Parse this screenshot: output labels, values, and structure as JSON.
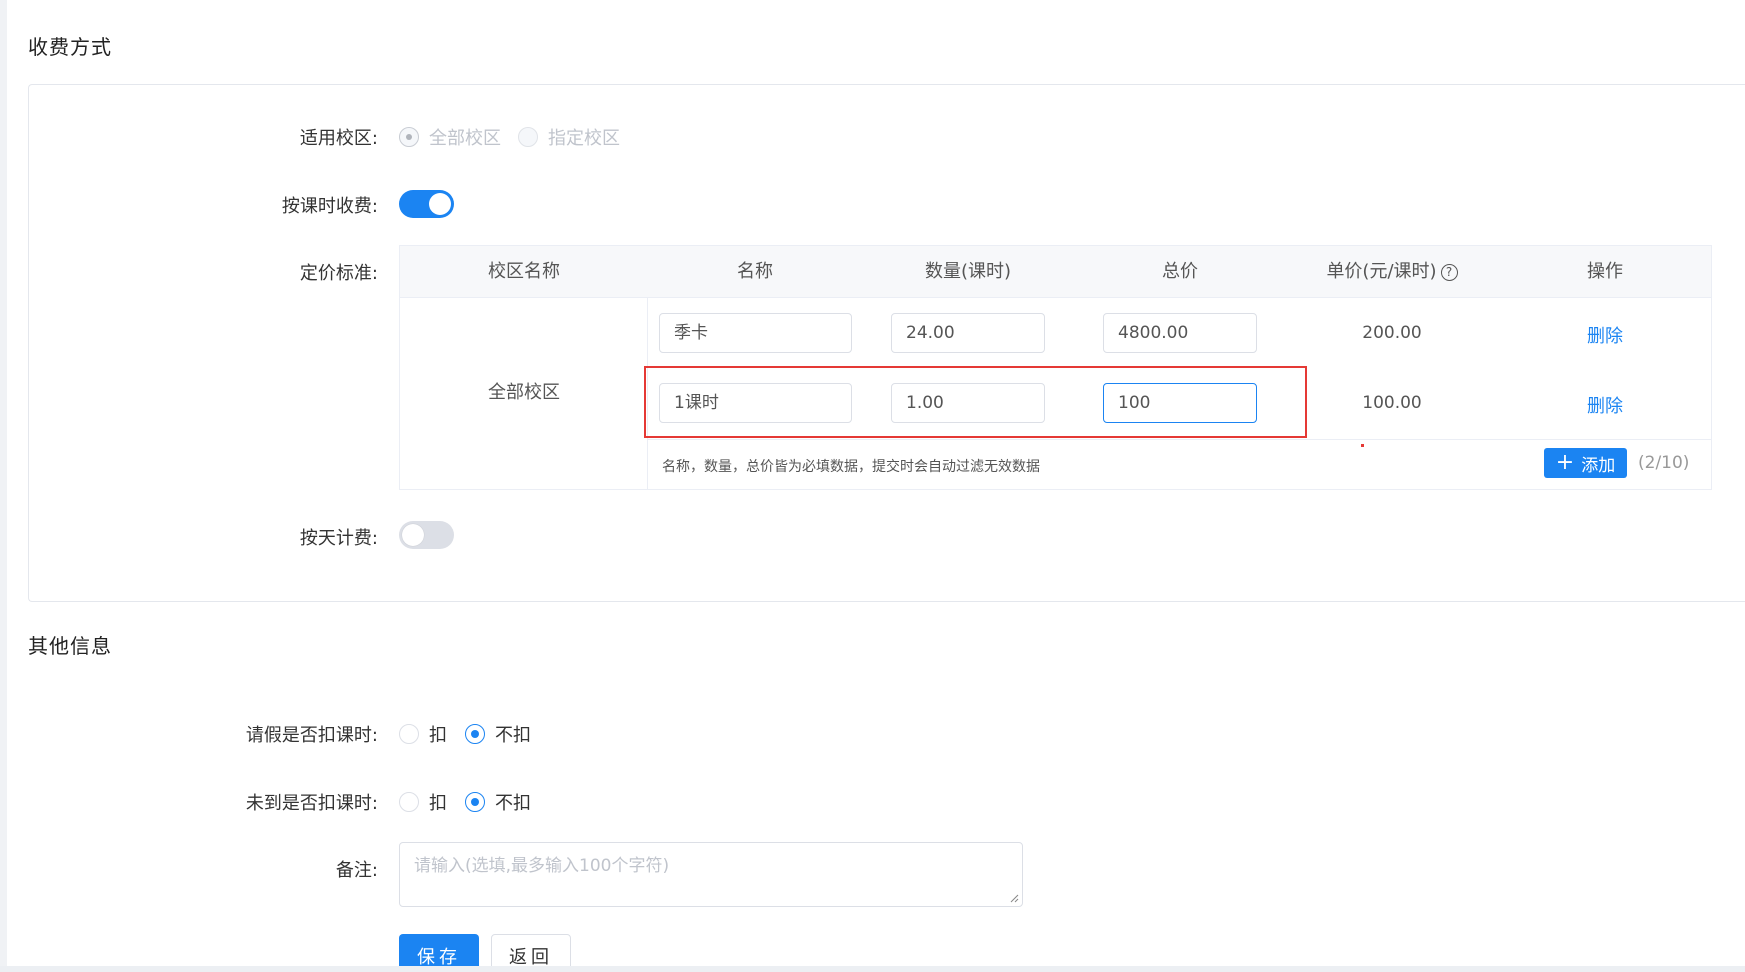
{
  "sections": {
    "fee_title": "收费方式",
    "other_title": "其他信息"
  },
  "campus_scope": {
    "label": "适用校区:",
    "options": [
      "全部校区",
      "指定校区"
    ],
    "selected": "全部校区"
  },
  "charge_by_hour": {
    "label": "按课时收费:",
    "enabled": true
  },
  "pricing": {
    "label": "定价标准:",
    "headers": [
      "校区名称",
      "名称",
      "数量(课时)",
      "总价",
      "单价(元/课时)",
      "操作"
    ],
    "campus": "全部校区",
    "rows": [
      {
        "name": "季卡",
        "quantity": "24.00",
        "total": "4800.00",
        "unit_price": "200.00",
        "action": "删除"
      },
      {
        "name": "1课时",
        "quantity": "1.00",
        "total": "100",
        "unit_price": "100.00",
        "action": "删除"
      }
    ],
    "hint": "名称，数量，总价皆为必填数据，提交时会自动过滤无效数据",
    "add_label": "添加",
    "count": "(2/10)"
  },
  "charge_by_day": {
    "label": "按天计费:",
    "enabled": false
  },
  "leave_deduct": {
    "label": "请假是否扣课时:",
    "options": [
      "扣",
      "不扣"
    ],
    "selected": "不扣"
  },
  "absent_deduct": {
    "label": "未到是否扣课时:",
    "options": [
      "扣",
      "不扣"
    ],
    "selected": "不扣"
  },
  "remark": {
    "label": "备注:",
    "placeholder": "请输入(选填,最多输入100个字符)"
  },
  "buttons": {
    "save": "保存",
    "back": "返回"
  },
  "colors": {
    "primary": "#1b84f2",
    "highlight": "#e53935"
  }
}
